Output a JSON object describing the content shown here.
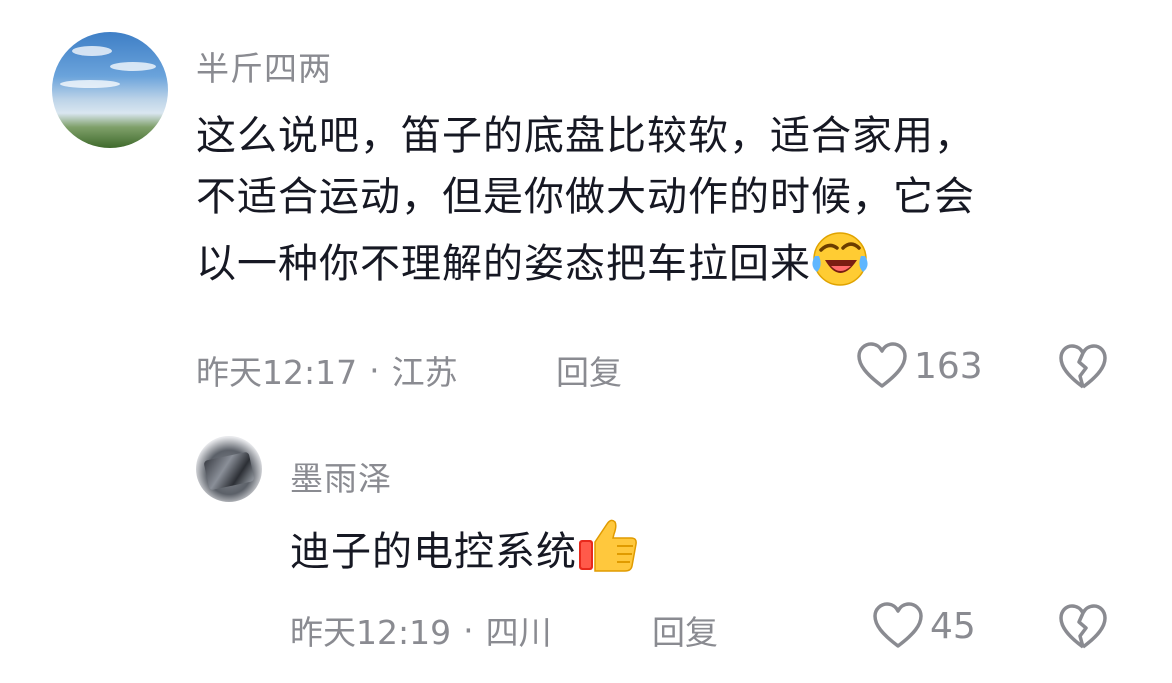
{
  "comment": {
    "username": "半斤四两",
    "lines": [
      "这么说吧，笛子的底盘比较软，适合家用，",
      "不适合运动，但是你做大动作的时候，它会",
      "以一种你不理解的姿态把车拉回来"
    ],
    "emoji": "laughing-crying-emoji",
    "time": "昨天12:17",
    "separator": "·",
    "location": "江苏",
    "reply_label": "回复",
    "like_count": "163"
  },
  "reply": {
    "username": "墨雨泽",
    "text": "迪子的电控系统",
    "emoji": "thumbs-up-emoji",
    "time": "昨天12:19",
    "separator": "·",
    "location": "四川",
    "reply_label": "回复",
    "like_count": "45"
  },
  "colors": {
    "text_primary": "#161823",
    "text_secondary": "#8a8b91"
  }
}
